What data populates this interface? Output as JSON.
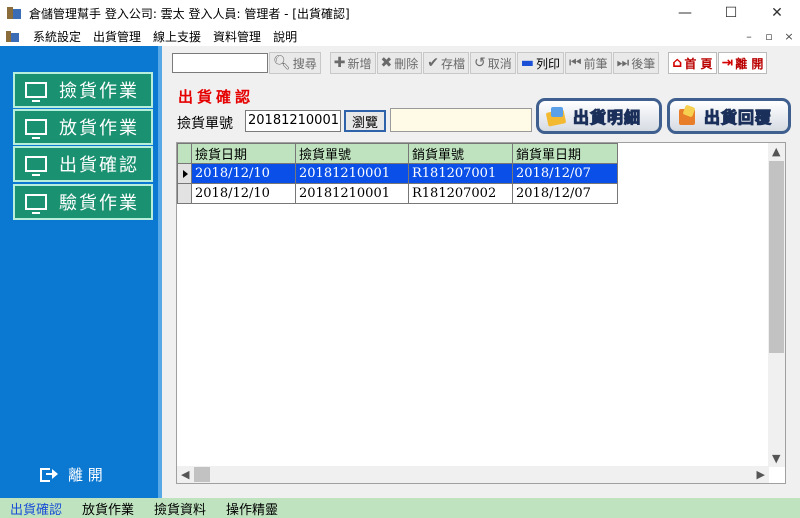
{
  "window": {
    "title": "倉儲管理幫手  登入公司: 雲太  登入人員: 管理者 - [出貨確認]",
    "controls": {
      "minimize": "—",
      "maximize": "☐",
      "close": "✕"
    },
    "mdi_controls": {
      "minimize": "–",
      "restore": "▫",
      "close": "×"
    }
  },
  "menu": [
    "系統設定",
    "出貨管理",
    "線上支援",
    "資料管理",
    "說明"
  ],
  "sidebar": {
    "items": [
      {
        "label": "撿貨作業"
      },
      {
        "label": "放貨作業"
      },
      {
        "label": "出貨確認"
      },
      {
        "label": "驗貨作業"
      }
    ],
    "leave_label": "離 開"
  },
  "toolbar": {
    "search_value": "",
    "search_label": "搜尋",
    "add_label": "新增",
    "delete_label": "刪除",
    "save_label": "存檔",
    "cancel_label": "取消",
    "print_label": "列印",
    "prev_label": "前筆",
    "next_label": "後筆",
    "home_label": "首 頁",
    "exit_label": "離 開"
  },
  "form": {
    "heading": "出貨確認",
    "pick_no_label": "撿貨單號",
    "pick_no_value": "20181210001",
    "browse_label": "瀏覽",
    "extra_value": "",
    "detail_button": "出貨明細",
    "reply_button": "出貨回覆"
  },
  "grid": {
    "columns": [
      "撿貨日期",
      "撿貨單號",
      "銷貨單號",
      "銷貨單日期"
    ],
    "rows": [
      [
        "2018/12/10",
        "20181210001",
        "R181207001",
        "2018/12/07"
      ],
      [
        "2018/12/10",
        "20181210001",
        "R181207002",
        "2018/12/07"
      ]
    ]
  },
  "status_tabs": [
    "出貨確認",
    "放貨作業",
    "撿貨資料",
    "操作精靈"
  ]
}
